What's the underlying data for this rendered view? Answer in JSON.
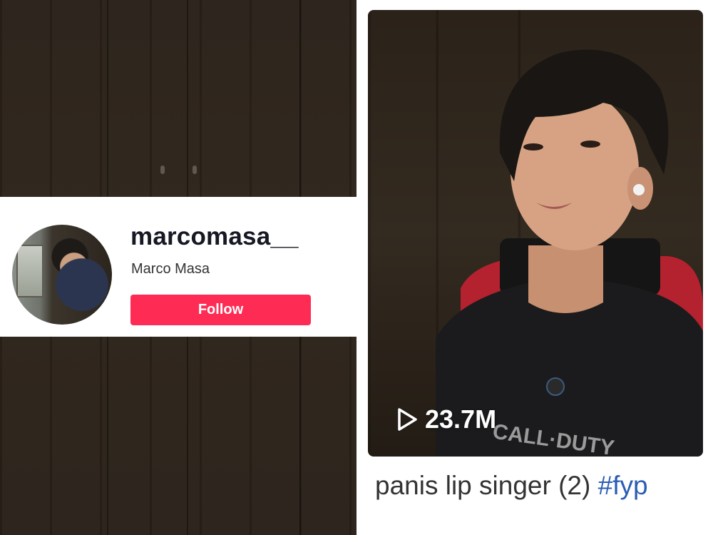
{
  "profile": {
    "username": "marcomasa__",
    "display_name": "Marco Masa",
    "follow_label": "Follow"
  },
  "video": {
    "views": "23.7M",
    "caption_text": "panis lip singer (2)",
    "hashtag": "#fyp"
  },
  "icons": {
    "play": "play-icon",
    "avatar": "avatar"
  },
  "colors": {
    "follow_button": "#fe2c55",
    "hashtag": "#2b5db4",
    "username": "#161823"
  }
}
